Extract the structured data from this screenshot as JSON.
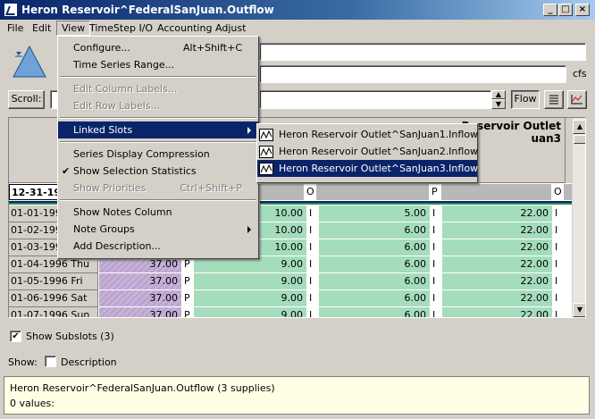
{
  "window": {
    "title": "Heron Reservoir^FederalSanJuan.Outflow"
  },
  "menubar": [
    "File",
    "Edit",
    "View",
    "TimeStep I/O",
    "Accounting",
    "Adjust"
  ],
  "units": "cfs",
  "scroll_label": "Scroll:",
  "flow_button": "Flow",
  "columns": {
    "col4_title": "Reservoir Outlet",
    "col4_sub": "uan3"
  },
  "flag_row": {
    "date": "12-31-19",
    "flag_col2": "O",
    "flag_col3": "P",
    "flag_col4": "O"
  },
  "rows": [
    {
      "date": "01-01-199",
      "v1": "",
      "f1": "",
      "v2": "10.00",
      "f2": "I",
      "v3": "5.00",
      "f3": "I",
      "v4": "22.00",
      "f4": "I"
    },
    {
      "date": "01-02-199",
      "v1": "",
      "f1": "",
      "v2": "10.00",
      "f2": "I",
      "v3": "6.00",
      "f3": "I",
      "v4": "22.00",
      "f4": "I"
    },
    {
      "date": "01-03-199",
      "v1": "",
      "f1": "",
      "v2": "10.00",
      "f2": "I",
      "v3": "6.00",
      "f3": "I",
      "v4": "22.00",
      "f4": "I"
    },
    {
      "date": "01-04-1996 Thu",
      "v1": "37.00",
      "f1": "P",
      "v2": "9.00",
      "f2": "I",
      "v3": "6.00",
      "f3": "I",
      "v4": "22.00",
      "f4": "I"
    },
    {
      "date": "01-05-1996 Fri",
      "v1": "37.00",
      "f1": "P",
      "v2": "9.00",
      "f2": "I",
      "v3": "6.00",
      "f3": "I",
      "v4": "22.00",
      "f4": "I"
    },
    {
      "date": "01-06-1996 Sat",
      "v1": "37.00",
      "f1": "P",
      "v2": "9.00",
      "f2": "I",
      "v3": "6.00",
      "f3": "I",
      "v4": "22.00",
      "f4": "I"
    },
    {
      "date": "01-07-1996 Sun",
      "v1": "37.00",
      "f1": "P",
      "v2": "9.00",
      "f2": "I",
      "v3": "6.00",
      "f3": "I",
      "v4": "22.00",
      "f4": "I"
    }
  ],
  "view_menu": {
    "configure": "Configure...",
    "configure_sc": "Alt+Shift+C",
    "ts_range": "Time Series Range...",
    "edit_col": "Edit Column Labels...",
    "edit_row": "Edit Row Labels...",
    "linked_slots": "Linked Slots",
    "compression": "Series Display Compression",
    "sel_stats": "Show Selection Statistics",
    "priorities": "Show Priorities",
    "priorities_sc": "Ctrl+Shift+P",
    "notes_col": "Show Notes Column",
    "note_groups": "Note Groups",
    "add_desc": "Add Description..."
  },
  "linked_submenu": [
    "Heron Reservoir Outlet^SanJuan1.Inflow",
    "Heron Reservoir Outlet^SanJuan2.Inflow",
    "Heron Reservoir Outlet^SanJuan3.Inflow"
  ],
  "show_subslots": "Show Subslots (3)",
  "show_label": "Show:",
  "description_label": "Description",
  "status": {
    "line1": "Heron Reservoir^FederalSanJuan.Outflow (3 supplies)",
    "line2": "0 values:"
  }
}
